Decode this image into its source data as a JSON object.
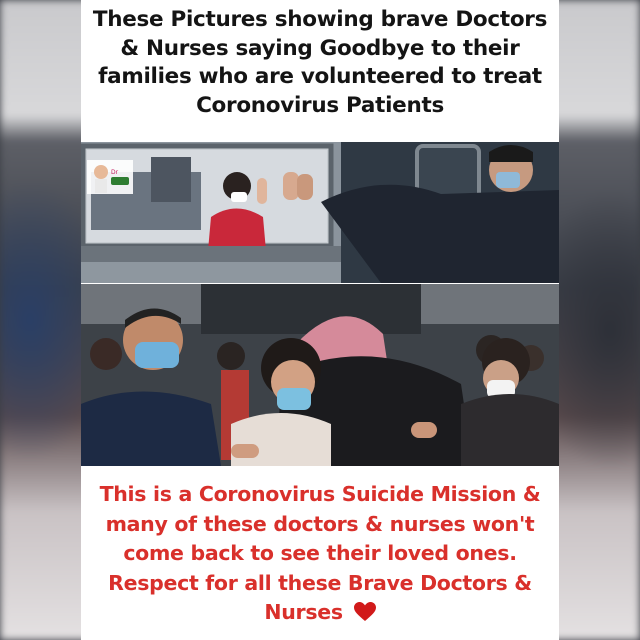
{
  "header": {
    "caption": "These Pictures showing brave Doctors & Nurses saying Goodbye to their families who are volunteered to treat Coronovirus Patients"
  },
  "photos": {
    "top_alt": "doctor",
    "bottom_alt": "hugging"
  },
  "footer": {
    "caption": "This is a Coronovirus Suicide Mission & many of these doctors & nurses won't come back to see their loved ones. Respect for all these Brave Doctors & Nurses"
  },
  "colors": {
    "caption_dark": "#141414",
    "caption_red": "#d9302b",
    "heart": "#d11a1a"
  },
  "icons": [
    "heart-icon",
    "doctor-sticker"
  ]
}
